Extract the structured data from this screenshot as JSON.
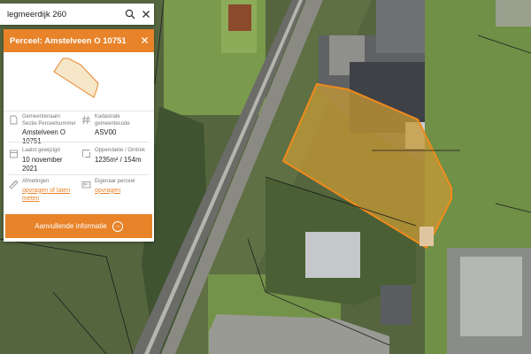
{
  "search": {
    "value": "legmeerdijk 260",
    "placeholder": ""
  },
  "panel": {
    "title": "Perceel: Amstelveen O 10751",
    "fields": [
      {
        "label": "Gemeentenaam Sectie Perceelnummer",
        "value": "Amstelveen O 10751",
        "icon": "document-icon"
      },
      {
        "label": "Kadastrale gemeentecode",
        "value": "ASV00",
        "icon": "hash-icon"
      },
      {
        "label": "Laatst gewijzigd",
        "value": "10 november 2021",
        "icon": "calendar-icon"
      },
      {
        "label": "Oppervlakte / Omtrek",
        "value": "1235m² / 154m",
        "icon": "area-icon"
      },
      {
        "label": "Afmetingen",
        "link": "opvragen of laten meten",
        "icon": "ruler-icon"
      },
      {
        "label": "Eigenaar perceel",
        "link": "opvragen",
        "icon": "id-card-icon"
      }
    ],
    "cta_label": "Aanvullende informatie"
  },
  "colors": {
    "accent": "#e8832a",
    "parcel_fill": "#c79a35",
    "parcel_border": "#f08a1c"
  }
}
